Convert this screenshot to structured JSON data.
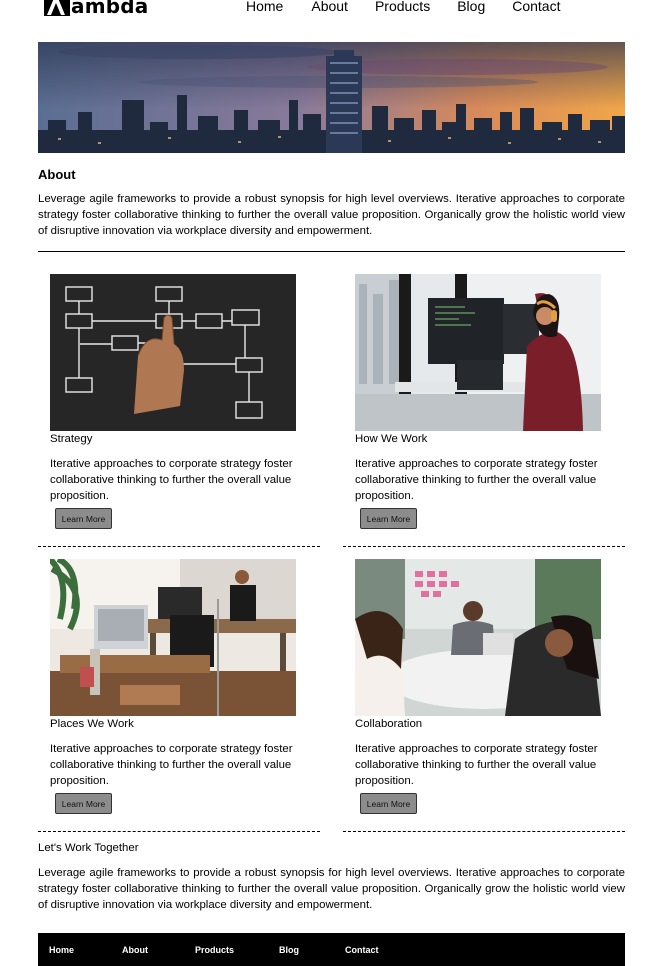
{
  "brand": {
    "logo_text": "ambda"
  },
  "nav": [
    "Home",
    "About",
    "Products",
    "Blog",
    "Contact"
  ],
  "about": {
    "title": "About",
    "text": "Leverage agile frameworks to provide a robust synopsis for high level overviews. Iterative approaches to corporate strategy foster collaborative thinking to further the overall value proposition. Organically grow the holistic world view of disruptive innovation via workplace diversity and empowerment."
  },
  "cards": [
    {
      "title": "Strategy",
      "desc": "Iterative approaches to corporate strategy foster collaborative thinking to further the overall value proposition.",
      "button": "Learn More"
    },
    {
      "title": "How We Work",
      "desc": "Iterative approaches to corporate strategy foster collaborative thinking to further the overall value proposition.",
      "button": "Learn More"
    },
    {
      "title": "Places We Work",
      "desc": "Iterative approaches to corporate strategy foster collaborative thinking to further the overall value proposition.",
      "button": "Learn More"
    },
    {
      "title": "Collaboration",
      "desc": "Iterative approaches to corporate strategy foster collaborative thinking to further the overall value proposition.",
      "button": "Learn More"
    }
  ],
  "together": {
    "title": "Let's Work Together",
    "text": "Leverage agile frameworks to provide a robust synopsis for high level overviews. Iterative approaches to corporate strategy foster collaborative thinking to further the overall value proposition. Organically grow the holistic world view of disruptive innovation via workplace diversity and empowerment."
  },
  "footer_nav": [
    "Home",
    "About",
    "Products",
    "Blog",
    "Contact"
  ],
  "colors": {
    "footer_bg": "#000000",
    "button_bg": "#8c8c8c"
  }
}
